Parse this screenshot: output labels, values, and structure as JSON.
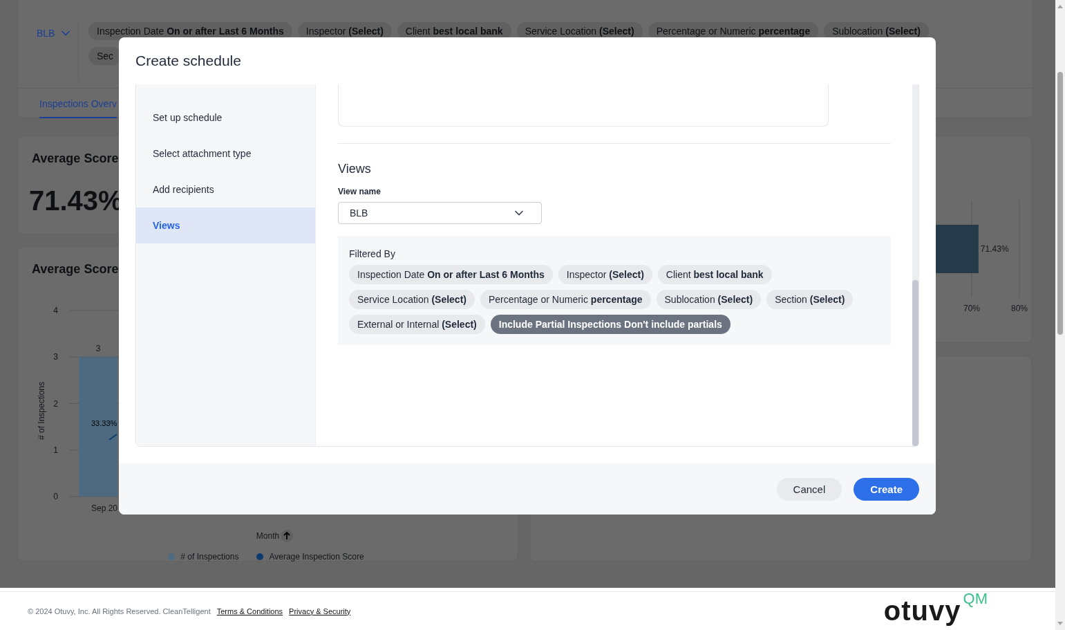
{
  "dashboard": {
    "view_selector": {
      "value": "BLB"
    },
    "filters": [
      {
        "label": "Inspection Date **On or after Last 6 Months**"
      },
      {
        "label": "Inspector **(Select)**"
      },
      {
        "label": "Client **best local bank**"
      },
      {
        "label": "Service Location **(Select)**"
      },
      {
        "label": "Percentage or Numeric **percentage**"
      },
      {
        "label": "Sublocation **(Select)**"
      },
      {
        "label": "Sec"
      }
    ],
    "tabs": [
      {
        "label": "Inspections Overv",
        "selected": true
      }
    ],
    "score_card": {
      "title": "Average Score",
      "value": "71.43%"
    },
    "score_chart_card": {
      "title": "Average Score",
      "chart_data": {
        "type": "bar",
        "categories": [
          "Sep 20"
        ],
        "series": [
          {
            "name": "# of Inspections",
            "color": "#4d6a80",
            "values": [
              3
            ]
          }
        ],
        "ylim": [
          0,
          4
        ],
        "yticks": [
          0,
          1,
          2,
          3,
          4
        ],
        "grid": true,
        "ylabel": "# of Inspections",
        "xlabel": "Month",
        "value_labels": [
          "3"
        ]
      },
      "line_label": "33.33%",
      "line_legend": {
        "label": "Average Inspection Score",
        "color": "#0b3c6e"
      }
    },
    "score_bar_card": {
      "chart_data": {
        "type": "bar",
        "orientation": "horizontal",
        "values": [
          71.43
        ],
        "xlim": [
          0,
          80
        ],
        "xticks": [
          {
            "value": 70,
            "label": "70%"
          },
          {
            "value": 80,
            "label": "80%"
          }
        ],
        "grid": true,
        "value_labels": [
          "71.43%"
        ]
      }
    }
  },
  "modal": {
    "title": "Create schedule",
    "steps": [
      {
        "label": "Set up schedule",
        "selected": false
      },
      {
        "label": "Select attachment type",
        "selected": false
      },
      {
        "label": "Add recipients",
        "selected": false
      },
      {
        "label": "Views",
        "selected": true
      }
    ],
    "section_title": "Views",
    "view_name": {
      "label": "View name",
      "value": "BLB"
    },
    "filtered_by": "Filtered By",
    "filters": [
      {
        "label": "Inspection Date **On or after Last 6 Months**",
        "active": false
      },
      {
        "label": "Inspector **(Select)**",
        "active": false
      },
      {
        "label": "Client **best local bank**",
        "active": false
      },
      {
        "label": "Service Location **(Select)**",
        "active": false
      },
      {
        "label": "Percentage or Numeric **percentage**",
        "active": false
      },
      {
        "label": "Sublocation **(Select)**",
        "active": false
      },
      {
        "label": "Section **(Select)**",
        "active": false
      },
      {
        "label": "External or Internal **(Select)**",
        "active": false
      },
      {
        "label": "Include Partial Inspections **Don't include partials**",
        "active": true
      }
    ],
    "buttons": [
      {
        "label": "Cancel",
        "kind": "secondary"
      },
      {
        "label": "Create",
        "kind": "primary"
      }
    ]
  },
  "footer": {
    "copyright": "© 2024 Otuvy, Inc. All Rights Reserved. CleanTelligent",
    "links": [
      "Terms & Conditions",
      "Privacy & Security"
    ],
    "logo": {
      "name": "otuvy",
      "suffix": "QM"
    }
  }
}
